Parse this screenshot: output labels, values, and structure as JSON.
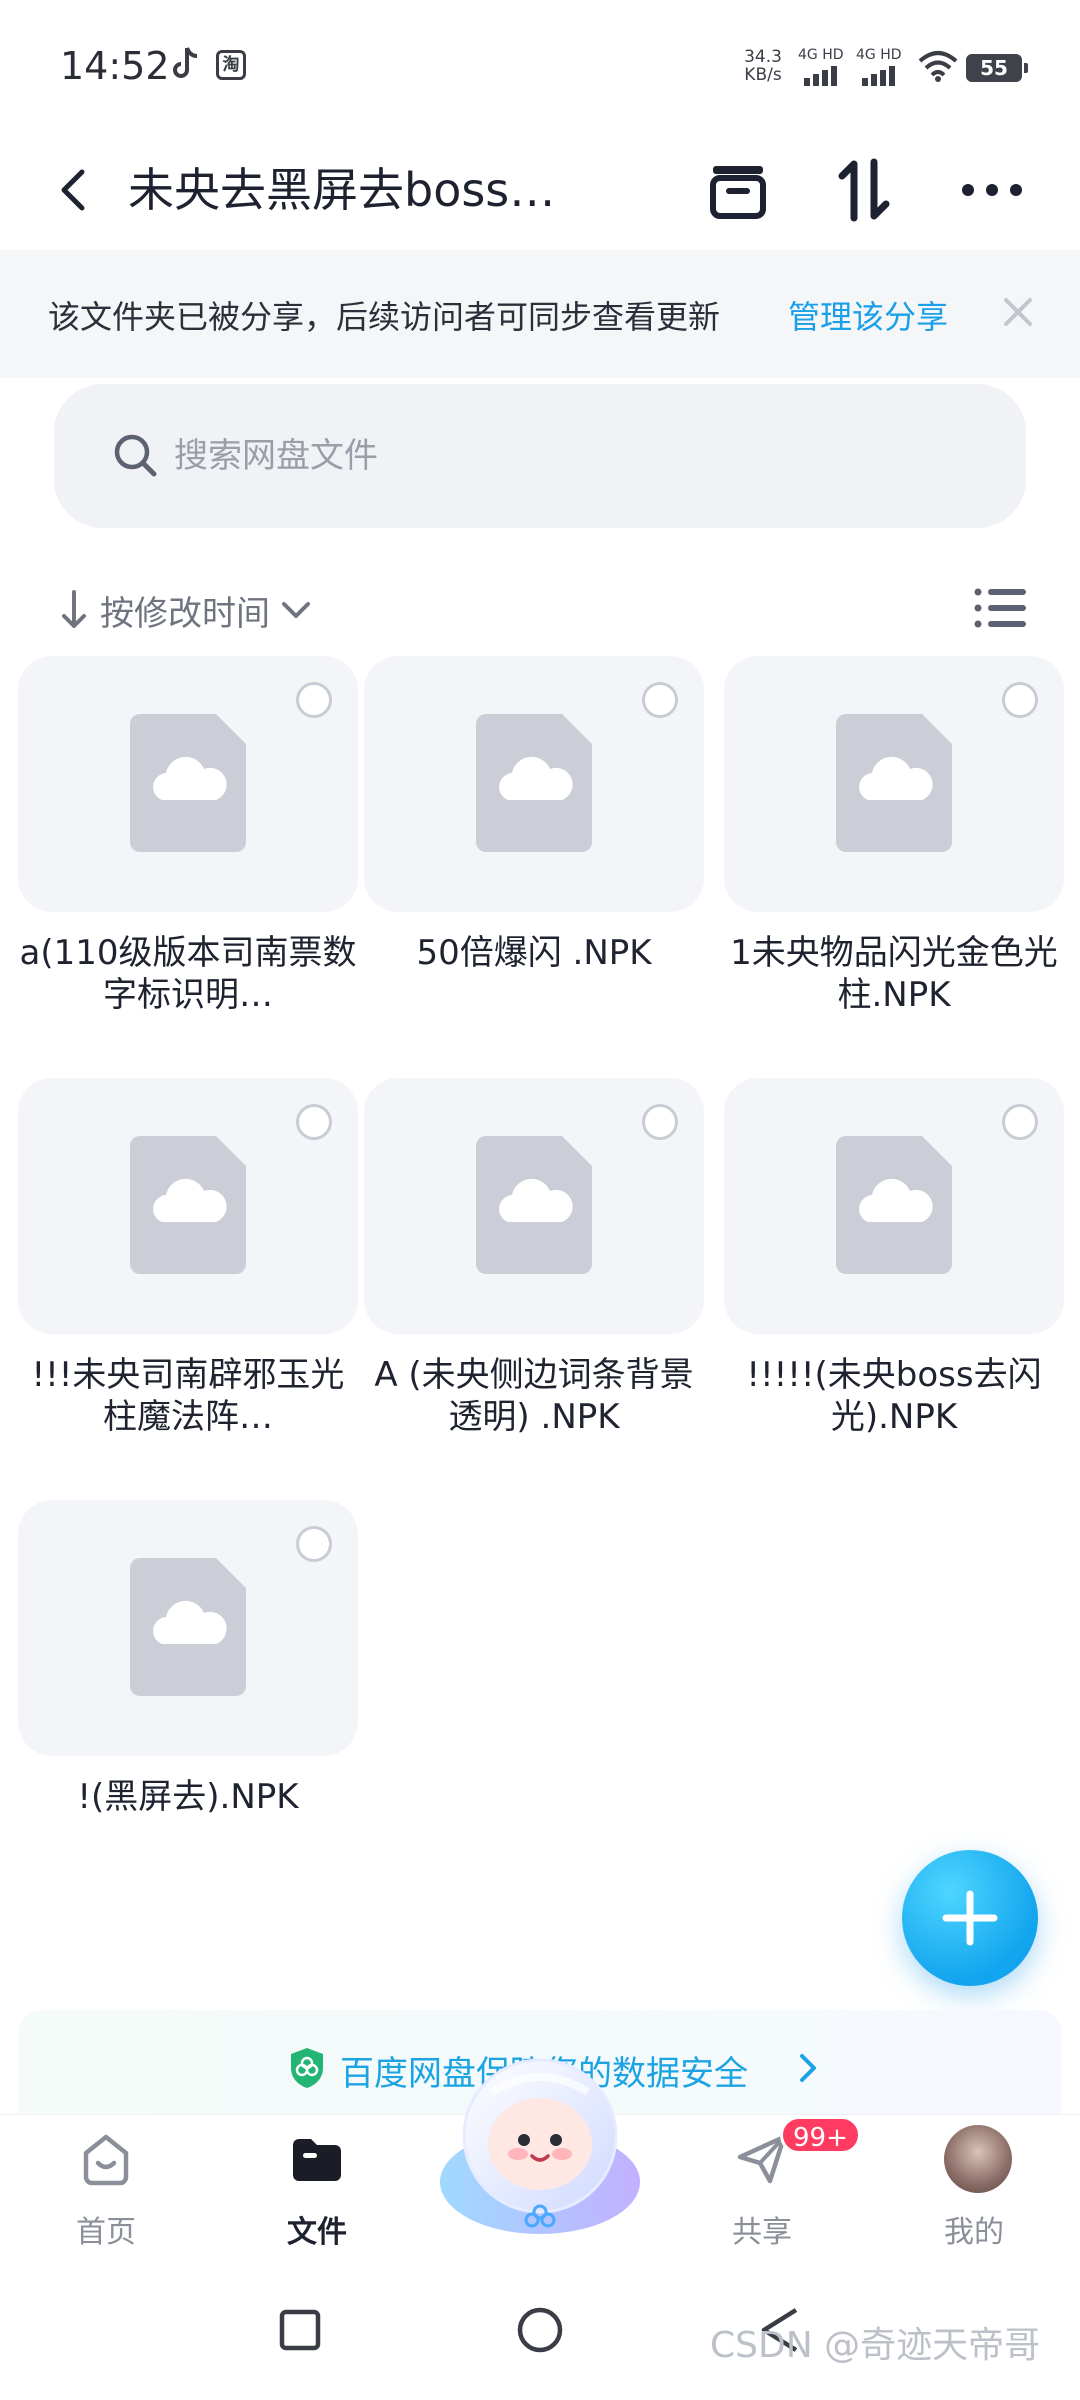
{
  "status_bar": {
    "time": "14:52",
    "net_speed_value": "34.3",
    "net_speed_unit": "KB/s",
    "signal1_label": "4G HD",
    "signal2_label": "4G HD",
    "battery": "55"
  },
  "header": {
    "title": "未央去黑屏去boss…"
  },
  "share_banner": {
    "text": "该文件夹已被分享，后续访问者可同步查看更新",
    "link": "管理该分享"
  },
  "search": {
    "placeholder": "搜索网盘文件"
  },
  "sort": {
    "label": "按修改时间"
  },
  "files": [
    {
      "name": "a(110级版本司南票数字标识明…"
    },
    {
      "name": "50倍爆闪 .NPK"
    },
    {
      "name": "1未央物品闪光金色光柱.NPK"
    },
    {
      "name": "!!!未央司南辟邪玉光柱魔法阵…"
    },
    {
      "name": "A (未央侧边词条背景透明) .NPK"
    },
    {
      "name": "!!!!!(未央boss去闪光).NPK"
    },
    {
      "name": "!(黑屏去).NPK"
    }
  ],
  "promo": {
    "text": "百度网盘保障您的数据安全"
  },
  "bottom_nav": {
    "items": [
      {
        "label": "首页"
      },
      {
        "label": "文件"
      },
      {
        "label": "共享"
      },
      {
        "label": "我的"
      }
    ],
    "share_badge": "99+"
  },
  "watermark": "CSDN @奇迹天帝哥",
  "colors": {
    "accent": "#1aa0e8",
    "badge": "#ff3b62",
    "fab": "#12a4ee"
  }
}
